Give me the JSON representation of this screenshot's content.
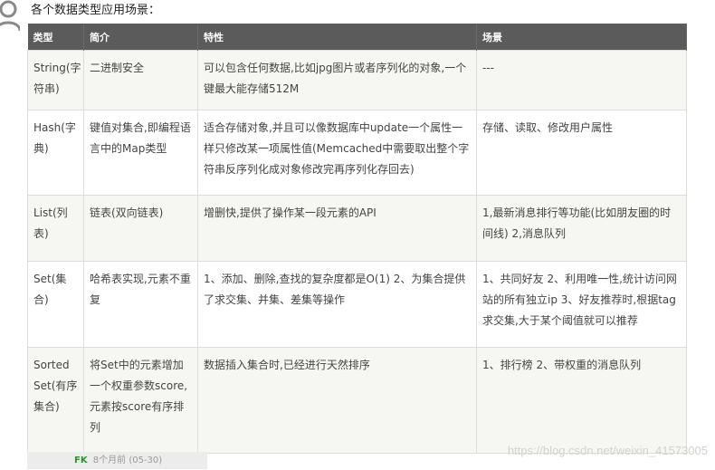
{
  "heading": "各个数据类型应用场景：",
  "table": {
    "headers": [
      "类型",
      "简介",
      "特性",
      "场景"
    ],
    "rows": [
      [
        "String(字符串)",
        "二进制安全",
        "可以包含任何数据,比如jpg图片或者序列化的对象,一个键最大能存储512M",
        "---"
      ],
      [
        "Hash(字典)",
        "键值对集合,即编程语言中的Map类型",
        "适合存储对象,并且可以像数据库中update一个属性一样只修改某一项属性值(Memcached中需要取出整个字符串反序列化成对象修改完再序列化存回去)",
        "存储、读取、修改用户属性"
      ],
      [
        "List(列表)",
        "链表(双向链表)",
        "增删快,提供了操作某一段元素的API",
        "1,最新消息排行等功能(比如朋友圈的时间线) 2,消息队列"
      ],
      [
        "Set(集合)",
        "哈希表实现,元素不重复",
        "1、添加、删除,查找的复杂度都是O(1) 2、为集合提供了求交集、并集、差集等操作",
        "1、共同好友 2、利用唯一性,统计访问网站的所有独立ip 3、好友推荐时,根据tag求交集,大于某个阈值就可以推荐"
      ],
      [
        "Sorted Set(有序集合)",
        "将Set中的元素增加一个权重参数score,元素按score有序排列",
        "数据插入集合时,已经进行天然排序",
        "1、排行榜 2、带权重的消息队列"
      ]
    ]
  },
  "footer": {
    "author": "FK",
    "time": "8个月前 (05-30)"
  },
  "watermark": "https://blog.csdn.net/weixin_41573005",
  "colors": {
    "header_bg": "#5b5b5b",
    "row_alt_bg": "#f6f6f2",
    "footer_bg": "#ececec",
    "author_green": "#2f8f2f"
  },
  "icons": [
    "user-avatar-icon"
  ]
}
